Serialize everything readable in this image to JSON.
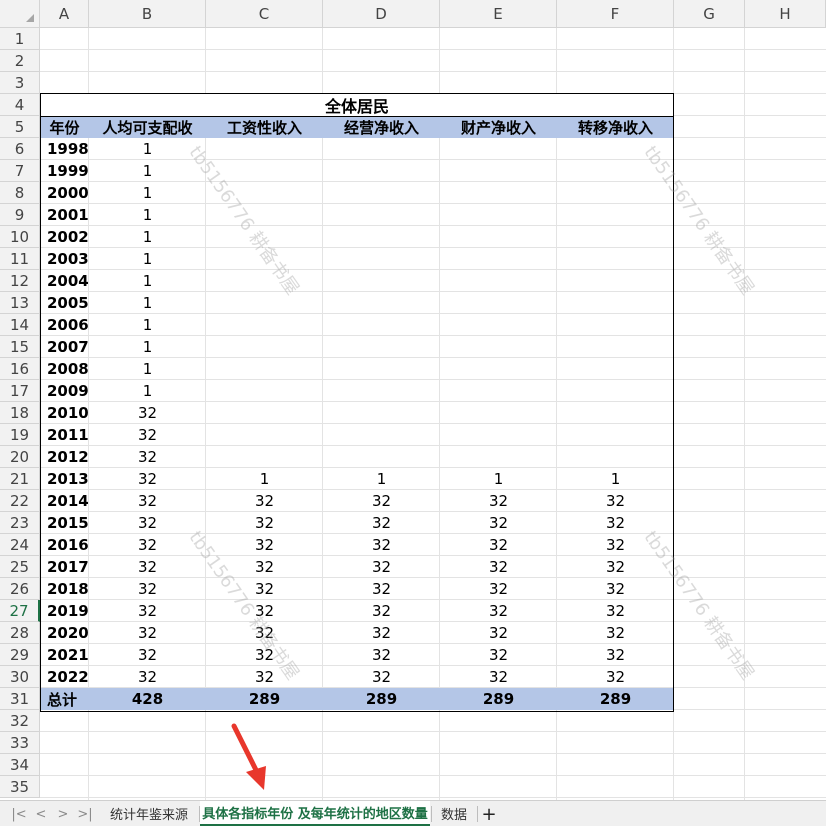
{
  "spreadsheet": {
    "columns": [
      "A",
      "B",
      "C",
      "D",
      "E",
      "F",
      "G",
      "H"
    ],
    "rows": [
      "1",
      "2",
      "3",
      "4",
      "5",
      "6",
      "7",
      "8",
      "9",
      "10",
      "11",
      "12",
      "13",
      "14",
      "15",
      "16",
      "17",
      "18",
      "19",
      "20",
      "21",
      "22",
      "23",
      "24",
      "25",
      "26",
      "27",
      "28",
      "29",
      "30",
      "31",
      "32",
      "33",
      "34",
      "35"
    ],
    "active_row": "27"
  },
  "table": {
    "title": "全体居民",
    "headers": [
      "年份",
      "人均可支配收",
      "工资性收入",
      "经营净收入",
      "财产净收入",
      "转移净收入"
    ],
    "rows": [
      [
        "1998",
        "1",
        "",
        "",
        "",
        ""
      ],
      [
        "1999",
        "1",
        "",
        "",
        "",
        ""
      ],
      [
        "2000",
        "1",
        "",
        "",
        "",
        ""
      ],
      [
        "2001",
        "1",
        "",
        "",
        "",
        ""
      ],
      [
        "2002",
        "1",
        "",
        "",
        "",
        ""
      ],
      [
        "2003",
        "1",
        "",
        "",
        "",
        ""
      ],
      [
        "2004",
        "1",
        "",
        "",
        "",
        ""
      ],
      [
        "2005",
        "1",
        "",
        "",
        "",
        ""
      ],
      [
        "2006",
        "1",
        "",
        "",
        "",
        ""
      ],
      [
        "2007",
        "1",
        "",
        "",
        "",
        ""
      ],
      [
        "2008",
        "1",
        "",
        "",
        "",
        ""
      ],
      [
        "2009",
        "1",
        "",
        "",
        "",
        ""
      ],
      [
        "2010",
        "32",
        "",
        "",
        "",
        ""
      ],
      [
        "2011",
        "32",
        "",
        "",
        "",
        ""
      ],
      [
        "2012",
        "32",
        "",
        "",
        "",
        ""
      ],
      [
        "2013",
        "32",
        "1",
        "1",
        "1",
        "1"
      ],
      [
        "2014",
        "32",
        "32",
        "32",
        "32",
        "32"
      ],
      [
        "2015",
        "32",
        "32",
        "32",
        "32",
        "32"
      ],
      [
        "2016",
        "32",
        "32",
        "32",
        "32",
        "32"
      ],
      [
        "2017",
        "32",
        "32",
        "32",
        "32",
        "32"
      ],
      [
        "2018",
        "32",
        "32",
        "32",
        "32",
        "32"
      ],
      [
        "2019",
        "32",
        "32",
        "32",
        "32",
        "32"
      ],
      [
        "2020",
        "32",
        "32",
        "32",
        "32",
        "32"
      ],
      [
        "2021",
        "32",
        "32",
        "32",
        "32",
        "32"
      ],
      [
        "2022",
        "32",
        "32",
        "32",
        "32",
        "32"
      ]
    ],
    "total": [
      "总计",
      "428",
      "289",
      "289",
      "289",
      "289"
    ]
  },
  "watermark_text": "tb5156776 耕备书屋",
  "sheet_tabs": {
    "nav": [
      "|<",
      "<",
      ">",
      ">|"
    ],
    "tabs": [
      {
        "label": "统计年鉴来源",
        "active": false
      },
      {
        "label": "具体各指标年份 及每年统计的地区数量",
        "active": true
      },
      {
        "label": "数据",
        "active": false
      }
    ],
    "add_label": "+"
  },
  "colors": {
    "header_fill": "#b4c6e7",
    "active_tab": "#1e7145",
    "arrow": "#e8372c"
  }
}
